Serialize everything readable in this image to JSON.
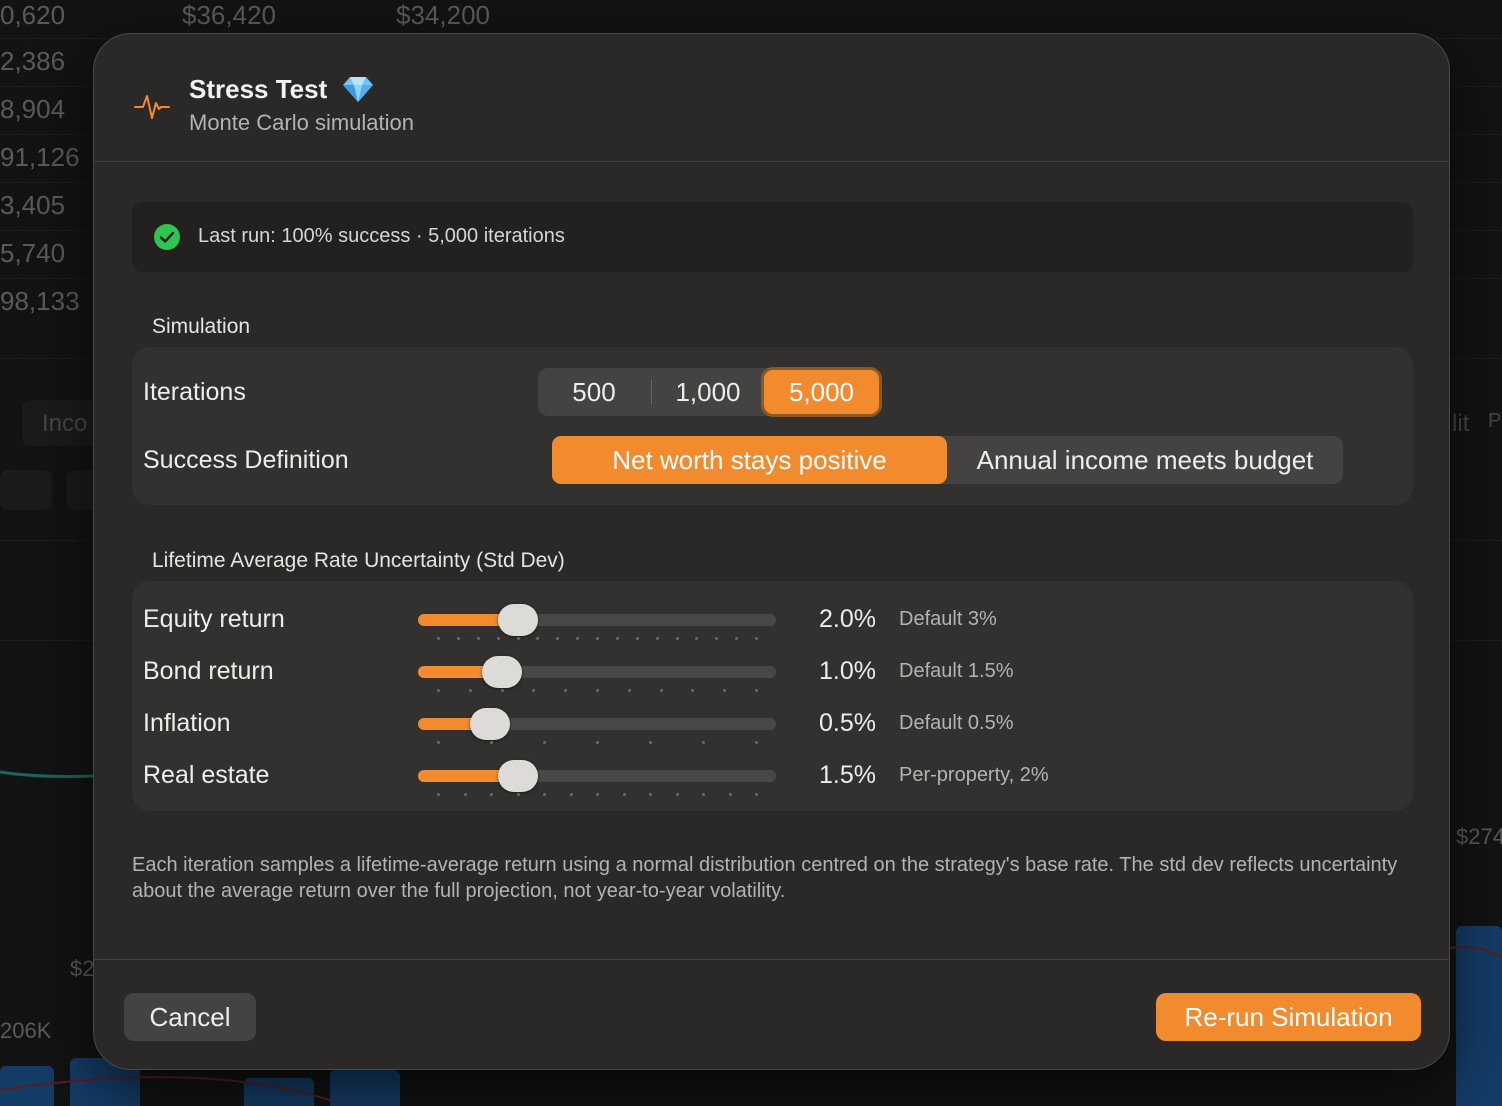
{
  "background": {
    "left_column_values": [
      "0,620",
      "2,386",
      "8,904",
      "91,126",
      "3,405",
      "5,740",
      "98,133"
    ],
    "top_values": [
      "$36,420",
      "$34,200"
    ],
    "tab_partial": "Inco",
    "right_partial_1": "lit",
    "right_partial_2": "P",
    "right_value_partial": "$274",
    "left_axis_partial_1": "$2",
    "left_axis_partial_2": "206K"
  },
  "dialog": {
    "title": "Stress Test",
    "subtitle": "Monte Carlo simulation",
    "title_icon": "waveform-icon",
    "badge_icon": "diamond-icon",
    "accent_color": "#f28a2e",
    "status": {
      "icon": "checkmark-circle-icon",
      "icon_color": "#30c552",
      "text": "Last run: 100% success · 5,000 iterations"
    },
    "simulation": {
      "section_label": "Simulation",
      "iterations_label": "Iterations",
      "iterations_options": [
        "500",
        "1,000",
        "5,000"
      ],
      "iterations_selected": "5,000",
      "success_label": "Success Definition",
      "success_options": [
        "Net worth stays positive",
        "Annual income meets budget"
      ],
      "success_selected": "Net worth stays positive"
    },
    "uncertainty": {
      "section_label": "Lifetime Average Rate Uncertainty (Std Dev)",
      "sliders": [
        {
          "label": "Equity return",
          "value": "2.0%",
          "hint": "Default 3%",
          "fraction": 0.28,
          "ticks": 17
        },
        {
          "label": "Bond return",
          "value": "1.0%",
          "hint": "Default 1.5%",
          "fraction": 0.235,
          "ticks": 11
        },
        {
          "label": "Inflation",
          "value": "0.5%",
          "hint": "Default 0.5%",
          "fraction": 0.2,
          "ticks": 7
        },
        {
          "label": "Real estate",
          "value": "1.5%",
          "hint": "Per-property, 2%",
          "fraction": 0.28,
          "ticks": 13
        }
      ]
    },
    "note": "Each iteration samples a lifetime-average return using a normal distribution centred on the strategy's base rate. The std dev reflects uncertainty about the average return over the full projection, not year-to-year volatility.",
    "buttons": {
      "cancel": "Cancel",
      "rerun": "Re-run Simulation"
    }
  }
}
